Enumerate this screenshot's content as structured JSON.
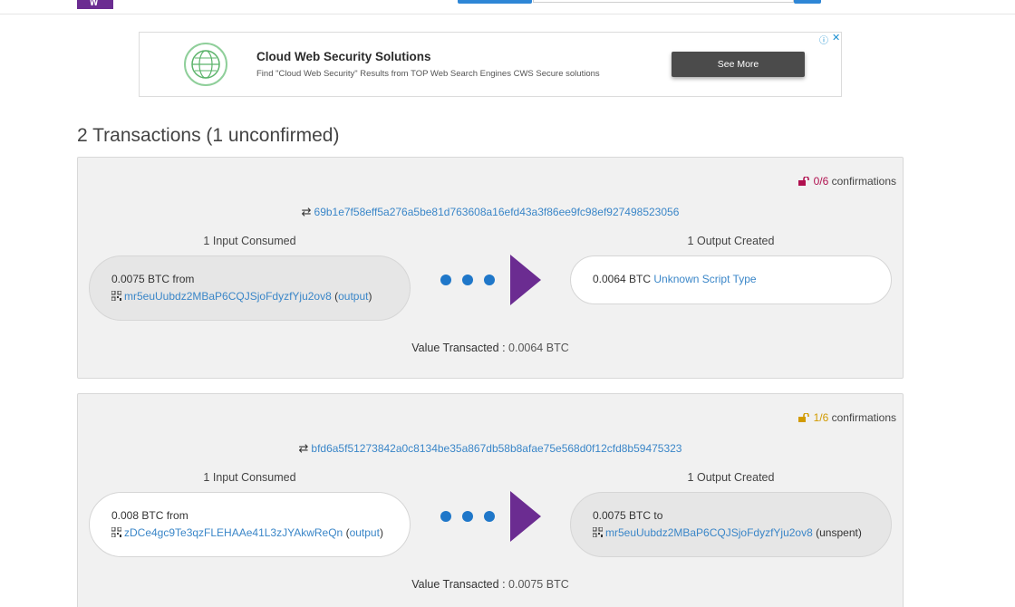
{
  "nav": {
    "logo_text": "\\/\\/"
  },
  "ad": {
    "title": "Cloud Web Security Solutions",
    "description": "Find \"Cloud Web Security\" Results from TOP Web Search Engines CWS Secure solutions",
    "button_label": "See More",
    "info_icon": "ⓘ",
    "close_icon": "✕"
  },
  "heading": "2 Transactions (1 unconfirmed)",
  "transactions": [
    {
      "confirmations_fraction": "0/6",
      "confirmations_label": "confirmations",
      "lock_color": "#b0104f",
      "hash": "69b1e7f58eff5a276a5be81d763608a16efd43a3f86ee9fc98ef927498523056",
      "inputs_label": "1 Input Consumed",
      "outputs_label": "1 Output Created",
      "input": {
        "amount": "0.0075 BTC",
        "from_word": "from",
        "address": "mr5euUubdz2MBaP6CQJSjoFdyzfYju2ov8",
        "link_label": "output"
      },
      "output": {
        "amount": "0.0064 BTC",
        "script_type": "Unknown Script Type"
      },
      "value_label": "Value Transacted :",
      "value": "0.0064 BTC"
    },
    {
      "confirmations_fraction": "1/6",
      "confirmations_label": "confirmations",
      "lock_color": "#d29b00",
      "hash": "bfd6a5f51273842a0c8134be35a867db58b8afae75e568d0f12cfd8b59475323",
      "inputs_label": "1 Input Consumed",
      "outputs_label": "1 Output Created",
      "input": {
        "amount": "0.008 BTC",
        "from_word": "from",
        "address": "zDCe4gc9Te3qzFLEHAAe41L3zJYAkwReQn",
        "link_label": "output"
      },
      "output": {
        "amount": "0.0075 BTC",
        "to_word": "to",
        "address": "mr5euUubdz2MBaP6CQJSjoFdyzfYju2ov8",
        "status": "(unspent)"
      },
      "value_label": "Value Transacted :",
      "value": "0.0075 BTC"
    }
  ],
  "colors": {
    "accent": "#6b2c91",
    "link": "#3a86c8",
    "dots": "#1f77c9"
  }
}
